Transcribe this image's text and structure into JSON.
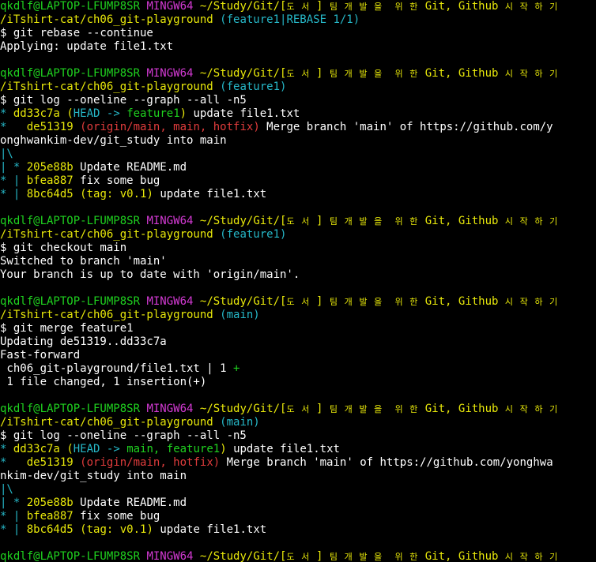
{
  "colors": {
    "background": "#000000",
    "text": "#ffffff",
    "prompt_user": "#1fd21f",
    "prompt_env": "#d43ad4",
    "path": "#e8e80a",
    "branch": "#26b8c8",
    "remote_ref": "#e03c3c",
    "graph": "#26b8c8"
  },
  "prompt": {
    "user": "qkdlf@LAPTOP-LFUMP8SR",
    "env": "MINGW64",
    "path_prefix": "~/Study/Git/[",
    "path_kr_1": "도 서 ",
    "path_bracket": "]",
    "path_kr_2": "팀 개 발 을  위 한",
    "path_mid": " Git, Github ",
    "path_kr_3": "시 작 하 기",
    "path_line2": "/iTshirt-cat/ch06_git-playground"
  },
  "blocks": [
    {
      "branch": "(feature1|REBASE 1/1)",
      "command": "$ git rebase --continue",
      "output": [
        "Applying: update file1.txt"
      ]
    },
    {
      "branch": "(feature1)",
      "command": "$ git log --oneline --graph --all -n5",
      "log": {
        "head_hash": "dd33c7a",
        "head_open": "(",
        "head_label": "HEAD -> ",
        "head_branches": "feature1",
        "head_close": ")",
        "head_msg": " update file1.txt",
        "merge_hash": "de51319",
        "merge_refs": "(origin/main, main, hotfix)",
        "merge_msg": " Merge branch 'main' of https://github.com/y",
        "merge_msg_wrap": "onghwankim-dev/git_study into main"
      }
    },
    {
      "branch": "(feature1)",
      "command": "$ git checkout main",
      "output": [
        "Switched to branch 'main'",
        "Your branch is up to date with 'origin/main'."
      ]
    },
    {
      "branch": "(main)",
      "command": "$ git merge feature1",
      "output": [
        "Updating de51319..dd33c7a",
        "Fast-forward"
      ],
      "stat_file": " ch06_git-playground/file1.txt | 1 ",
      "stat_plus": "+",
      "stat_summary": " 1 file changed, 1 insertion(+)"
    },
    {
      "branch": "(main)",
      "command": "$ git log --oneline --graph --all -n5",
      "log": {
        "head_hash": "dd33c7a",
        "head_open": "(",
        "head_label": "HEAD -> ",
        "head_branches": "main, feature1",
        "head_close": ")",
        "head_msg": " update file1.txt",
        "merge_hash": "de51319",
        "merge_refs": "(origin/main, hotfix)",
        "merge_msg": " Merge branch 'main' of https://github.com/yonghwa",
        "merge_msg_wrap": "nkim-dev/git_study into main"
      }
    }
  ],
  "common_log": {
    "graph_star": "* ",
    "graph_merge_prefix": "*   ",
    "graph_branch": "|\\",
    "graph_pipe_star": "| * ",
    "graph_star_pipe": "* | ",
    "readme_hash": "205e88b",
    "readme_msg": " Update README.md",
    "bug_hash": "bfea887",
    "bug_msg": " fix some bug",
    "tag_hash": "8bc64d5",
    "tag_open": "(",
    "tag_label": "tag: v0.1",
    "tag_close": ")",
    "tag_msg": " update file1.txt"
  }
}
